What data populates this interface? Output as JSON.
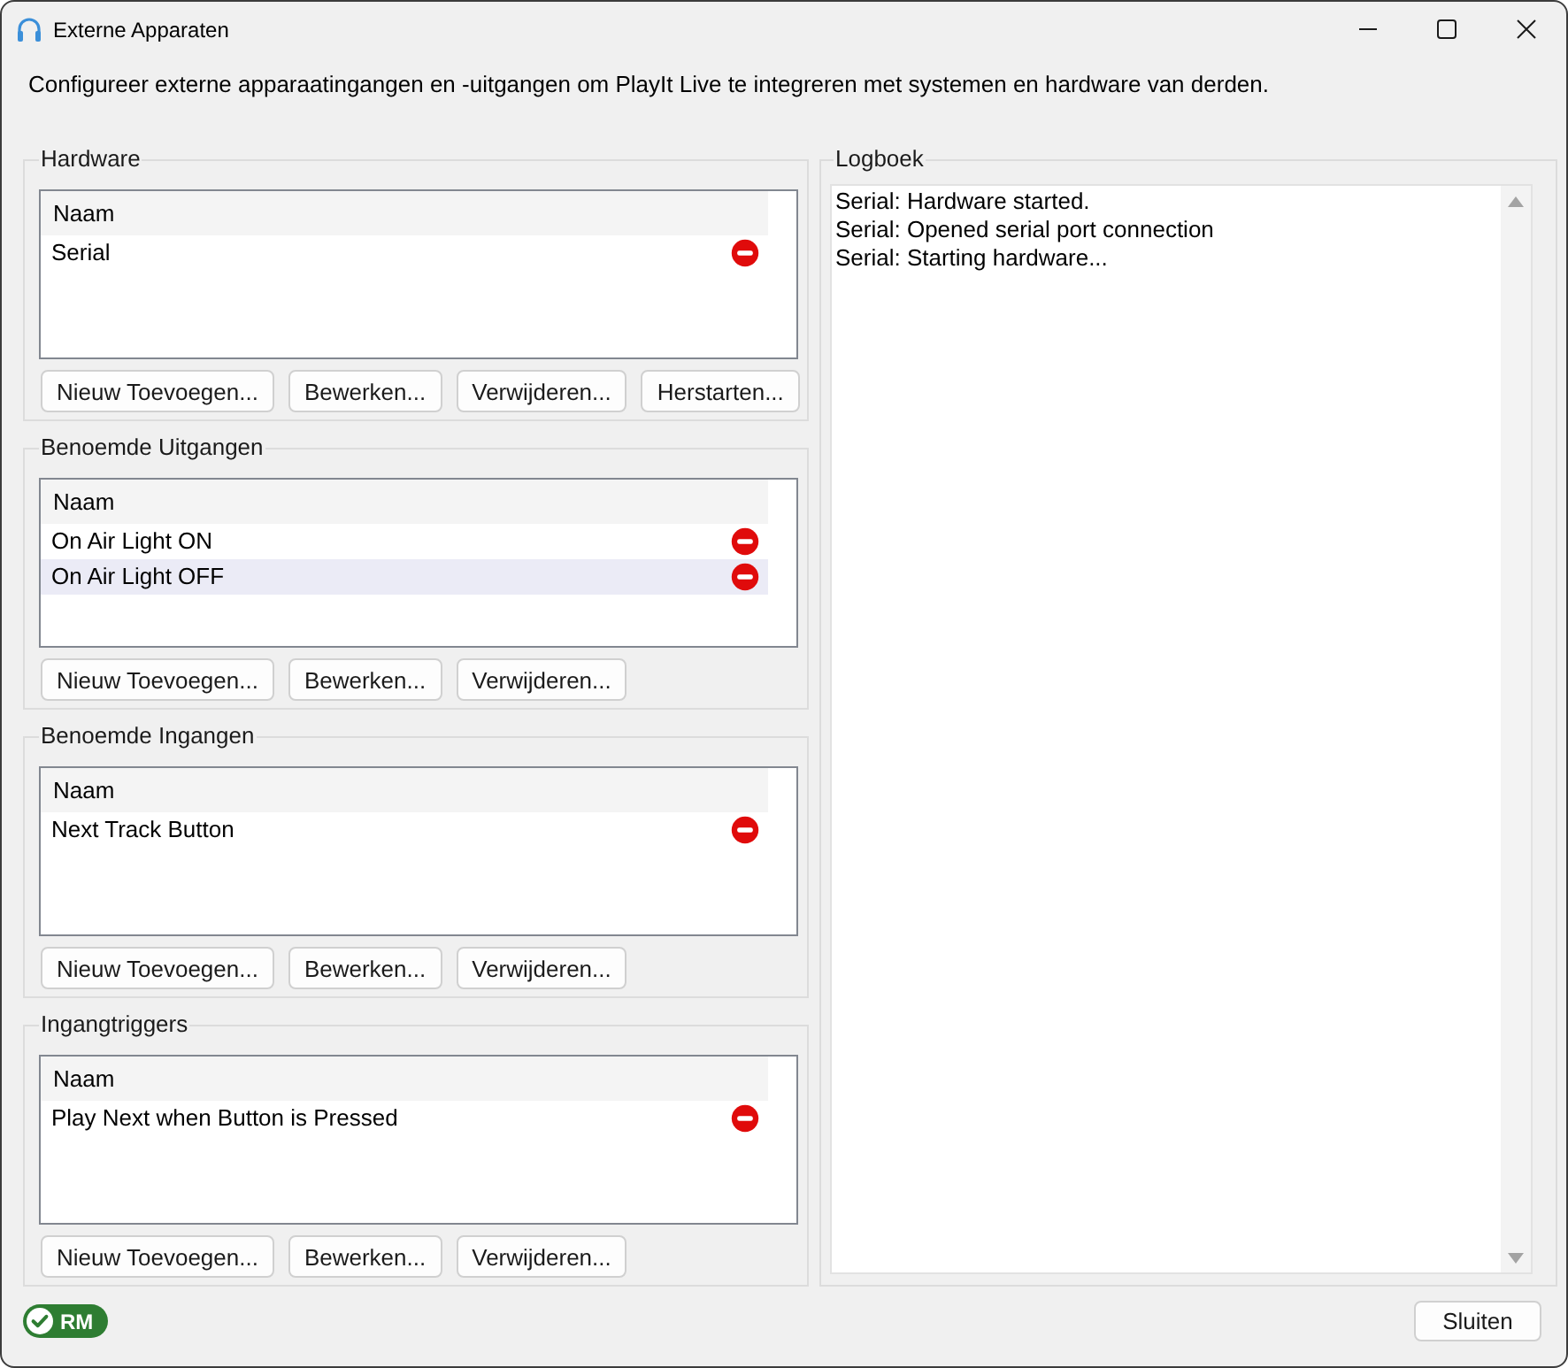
{
  "window": {
    "title": "Externe Apparaten"
  },
  "description": "Configureer externe apparaatingangen en -uitgangen om PlayIt Live te integreren met systemen en hardware van derden.",
  "groups": [
    {
      "title": "Hardware",
      "column": "Naam",
      "rows": [
        {
          "name": "Serial",
          "selected": false
        }
      ],
      "buttons": [
        "Nieuw Toevoegen...",
        "Bewerken...",
        "Verwijderen...",
        "Herstarten..."
      ]
    },
    {
      "title": "Benoemde Uitgangen",
      "column": "Naam",
      "rows": [
        {
          "name": "On Air Light ON",
          "selected": false
        },
        {
          "name": "On Air Light OFF",
          "selected": true
        }
      ],
      "buttons": [
        "Nieuw Toevoegen...",
        "Bewerken...",
        "Verwijderen..."
      ]
    },
    {
      "title": "Benoemde Ingangen",
      "column": "Naam",
      "rows": [
        {
          "name": "Next Track Button",
          "selected": false
        }
      ],
      "buttons": [
        "Nieuw Toevoegen...",
        "Bewerken...",
        "Verwijderen..."
      ]
    },
    {
      "title": "Ingangtriggers",
      "column": "Naam",
      "rows": [
        {
          "name": "Play Next when Button is Pressed",
          "selected": false
        }
      ],
      "buttons": [
        "Nieuw Toevoegen...",
        "Bewerken...",
        "Verwijderen..."
      ]
    }
  ],
  "log": {
    "title": "Logboek",
    "lines": [
      "Serial: Hardware started.",
      "Serial: Opened serial port connection",
      "Serial: Starting hardware..."
    ]
  },
  "status_badge": {
    "label": "RM"
  },
  "close_button": {
    "label": "Sluiten"
  }
}
